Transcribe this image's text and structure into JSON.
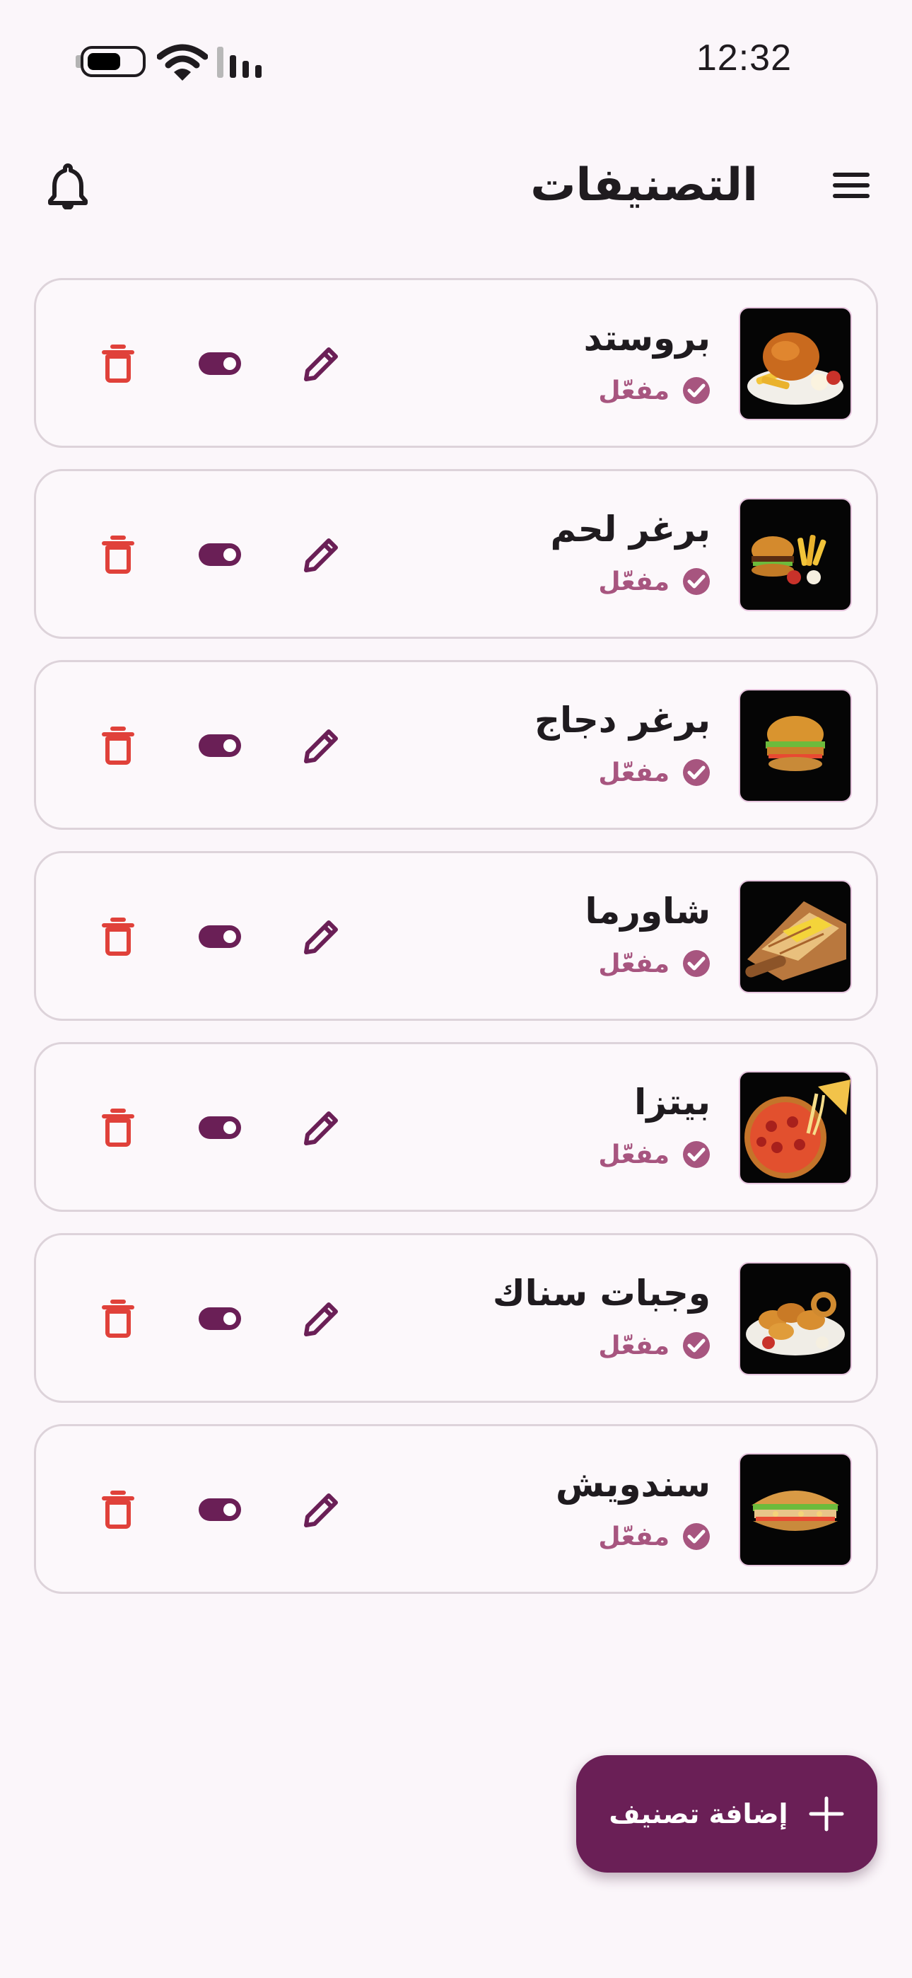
{
  "status_bar": {
    "time": "12:32",
    "icons": [
      "battery-icon",
      "wifi-icon",
      "signal-icon"
    ]
  },
  "header": {
    "title": "التصنيفات",
    "left_icon": "bell-icon",
    "right_icon": "menu-icon"
  },
  "categories": [
    {
      "name": "بروستد",
      "status": "مفعّل",
      "image": "broasted-chicken-image"
    },
    {
      "name": "برغر لحم",
      "status": "مفعّل",
      "image": "beef-burger-image"
    },
    {
      "name": "برغر دجاج",
      "status": "مفعّل",
      "image": "chicken-burger-image"
    },
    {
      "name": "شاورما",
      "status": "مفعّل",
      "image": "shawarma-image"
    },
    {
      "name": "بيتزا",
      "status": "مفعّل",
      "image": "pizza-image"
    },
    {
      "name": "وجبات سناك",
      "status": "مفعّل",
      "image": "snack-meals-image"
    },
    {
      "name": "سندويش",
      "status": "مفعّل",
      "image": "sandwich-image"
    }
  ],
  "actions": {
    "edit_icon": "pencil-icon",
    "toggle_icon": "toggle-icon",
    "delete_icon": "trash-icon"
  },
  "fab": {
    "label": "إضافة تصنيف",
    "icon": "plus-icon"
  },
  "colors": {
    "primary": "#6a1f56",
    "status_text": "#a7557f",
    "delete": "#e0413a",
    "background": "#fbf6fa",
    "card_border": "#ddd3da"
  }
}
